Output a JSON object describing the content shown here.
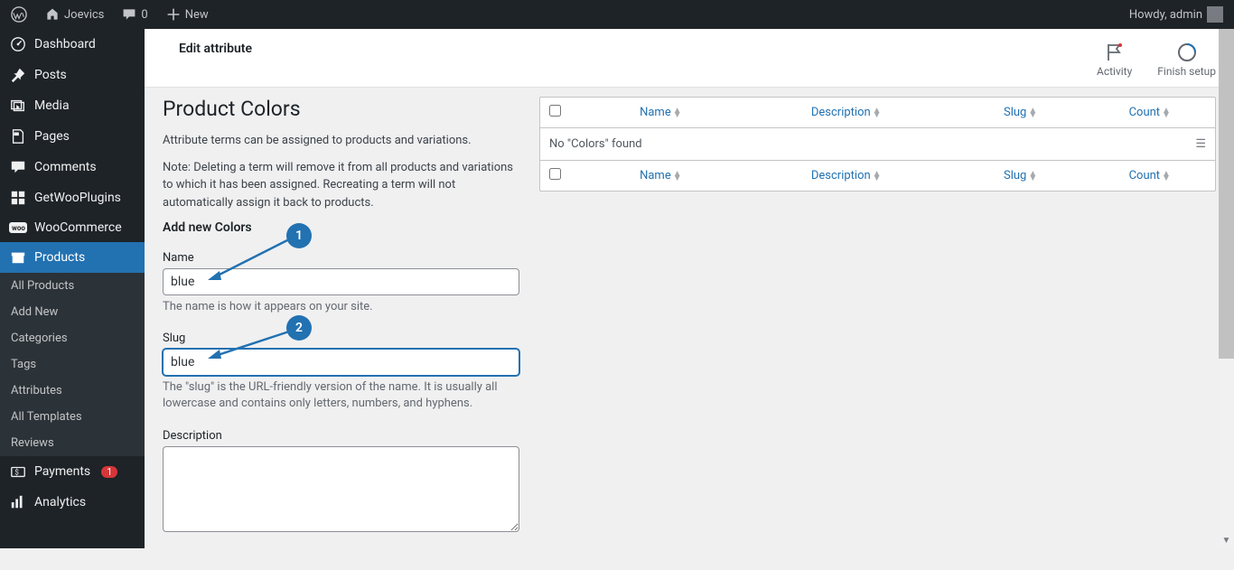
{
  "toolbar": {
    "site_name": "Joevics",
    "comment_count": "0",
    "new_label": "New",
    "howdy": "Howdy, admin"
  },
  "sidebar": {
    "items": [
      {
        "label": "Dashboard",
        "icon": "dashboard"
      },
      {
        "label": "Posts",
        "icon": "pin"
      },
      {
        "label": "Media",
        "icon": "media"
      },
      {
        "label": "Pages",
        "icon": "page"
      },
      {
        "label": "Comments",
        "icon": "comment"
      },
      {
        "label": "GetWooPlugins",
        "icon": "block"
      },
      {
        "label": "WooCommerce",
        "icon": "woo"
      },
      {
        "label": "Products",
        "icon": "archive",
        "active": true
      },
      {
        "label": "Payments",
        "icon": "currency",
        "badge": "1"
      },
      {
        "label": "Analytics",
        "icon": "stats"
      }
    ],
    "sub_items": [
      "All Products",
      "Add New",
      "Categories",
      "Tags",
      "Attributes",
      "All Templates",
      "Reviews"
    ]
  },
  "header": {
    "title": "Edit attribute",
    "activity": "Activity",
    "finish": "Finish setup"
  },
  "page": {
    "title": "Product Colors",
    "intro": "Attribute terms can be assigned to products and variations.",
    "note": "Note: Deleting a term will remove it from all products and variations to which it has been assigned. Recreating a term will not automatically assign it back to products.",
    "add_title": "Add new Colors",
    "name_label": "Name",
    "name_value": "blue",
    "name_helper": "The name is how it appears on your site.",
    "slug_label": "Slug",
    "slug_value": "blue",
    "slug_helper": "The \"slug\" is the URL-friendly version of the name. It is usually all lowercase and contains only letters, numbers, and hyphens.",
    "desc_label": "Description"
  },
  "table": {
    "cols": {
      "name": "Name",
      "desc": "Description",
      "slug": "Slug",
      "count": "Count"
    },
    "empty": "No \"Colors\" found"
  },
  "annotations": {
    "one": "1",
    "two": "2"
  }
}
